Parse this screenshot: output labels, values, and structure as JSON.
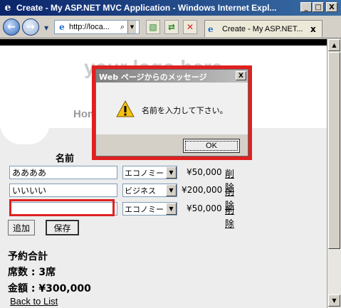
{
  "window": {
    "title": "Create - My ASP.NET MVC Application - Windows Internet Expl...",
    "minimize": "_",
    "maximize": "□",
    "close": "X"
  },
  "toolbar": {
    "back_icon": "arrow-left",
    "forward_icon": "arrow-right",
    "address": "http://loca...",
    "tab_title": "Create - My ASP.NET...",
    "tab_close": "x"
  },
  "page": {
    "logo": "your logo here",
    "menu_home": "Hom",
    "menu_contact": "t",
    "column_header": "名前",
    "rows": [
      {
        "name": "ああああ",
        "class": "エコノミー",
        "price": "¥50,000",
        "delete": "削除"
      },
      {
        "name": "いいいい",
        "class": "ビジネス",
        "price": "¥200,000",
        "delete": "削除"
      },
      {
        "name": "",
        "class": "エコノミー",
        "price": "¥50,000",
        "delete": "削除"
      }
    ],
    "add_button": "追加",
    "save_button": "保存",
    "summary_title": "予約合計",
    "summary_seats": "席数 : 3席",
    "summary_amount": "金額 : ¥300,000",
    "back_link": "Back to List"
  },
  "dialog": {
    "title": "Web ページからのメッセージ",
    "message": "名前を入力して下さい。",
    "ok": "OK",
    "close": "X",
    "icon": "warning-icon"
  },
  "colors": {
    "highlight_red": "#e02020",
    "titlebar_start": "#0a246a",
    "titlebar_end": "#3a6ea5"
  }
}
